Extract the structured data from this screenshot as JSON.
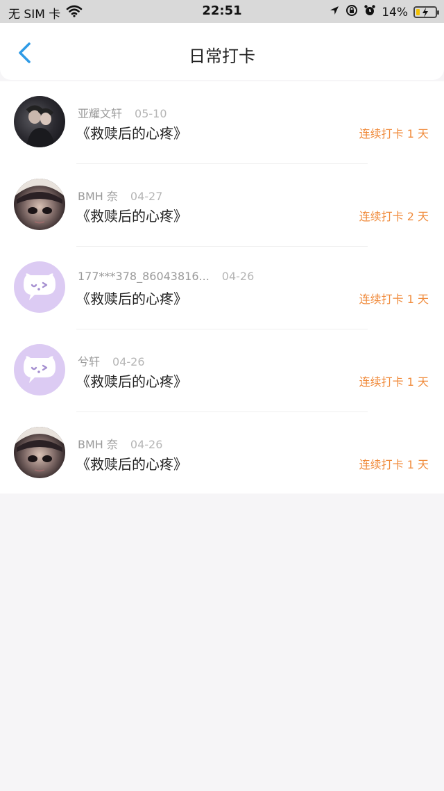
{
  "status_bar": {
    "carrier": "无 SIM 卡",
    "time": "22:51",
    "battery": "14%",
    "icons": [
      "wifi-icon",
      "location-icon",
      "orientation-lock-icon",
      "alarm-icon",
      "battery-icon"
    ]
  },
  "nav": {
    "title": "日常打卡",
    "back_icon": "chevron-left-icon"
  },
  "colors": {
    "accent_blue": "#2f9be6",
    "streak_orange": "#f08a3a",
    "mascot_bg": "#dccbf3"
  },
  "items": [
    {
      "name": "亚耀文轩",
      "date": "05-10",
      "title": "《救赎后的心疼》",
      "streak": "连续打卡 1 天",
      "avatar": "photo"
    },
    {
      "name": "BMH 奈",
      "date": "04-27",
      "title": "《救赎后的心疼》",
      "streak": "连续打卡 2 天",
      "avatar": "photo"
    },
    {
      "name": "177***378_86043816...",
      "date": "04-26",
      "title": "《救赎后的心疼》",
      "streak": "连续打卡 1 天",
      "avatar": "mascot"
    },
    {
      "name": "兮轩",
      "date": "04-26",
      "title": "《救赎后的心疼》",
      "streak": "连续打卡 1 天",
      "avatar": "mascot"
    },
    {
      "name": "BMH 奈",
      "date": "04-26",
      "title": "《救赎后的心疼》",
      "streak": "连续打卡 1 天",
      "avatar": "photo"
    }
  ]
}
